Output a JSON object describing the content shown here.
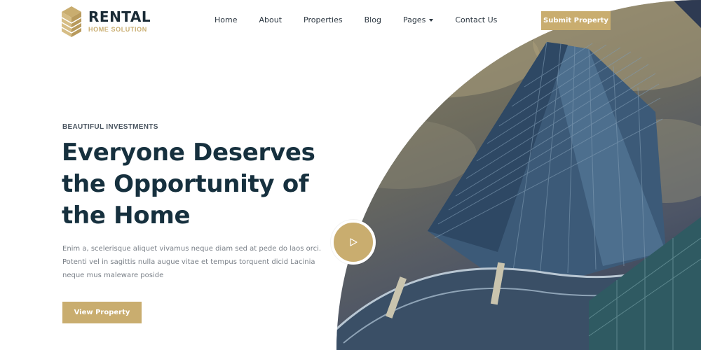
{
  "brand": {
    "name": "RENTAL",
    "tagline": "HOME SOLUTION",
    "logo_icon": "stacked-house-icon"
  },
  "nav": {
    "items": [
      {
        "label": "Home"
      },
      {
        "label": "About"
      },
      {
        "label": "Properties"
      },
      {
        "label": "Blog"
      },
      {
        "label": "Pages",
        "has_dropdown": true
      },
      {
        "label": "Contact Us"
      }
    ]
  },
  "header": {
    "submit_label": "Submit Property"
  },
  "hero": {
    "eyebrow": "BEAUTIFUL INVESTMENTS",
    "headline_lines": [
      "Everyone Deserves",
      "the Opportunity of",
      "the Home"
    ],
    "description_lines": [
      "Enim a, scelerisque aliquet vivamus neque diam sed at pede do laos orci.",
      "Potenti vel in sagittis nulla augue vitae et tempus torquent dicid Lacinia",
      "neque mus maleware poside"
    ],
    "cta_label": "View Property",
    "play_icon": "play-icon"
  },
  "colors": {
    "accent": "#c9ad6f",
    "heading": "#16303e",
    "body_text": "#7a8088"
  }
}
